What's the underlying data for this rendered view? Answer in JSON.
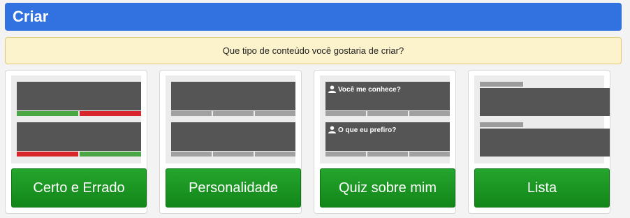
{
  "header": {
    "title": "Criar"
  },
  "prompt": {
    "text": "Que tipo de conteúdo você gostaria de criar?"
  },
  "cards": [
    {
      "button_label": "Certo e Errado"
    },
    {
      "button_label": "Personalidade"
    },
    {
      "button_label": "Quiz sobre mim",
      "questions": [
        "Você me conhece?",
        "O que eu prefiro?"
      ]
    },
    {
      "button_label": "Lista"
    }
  ],
  "colors": {
    "header": "#3272e0",
    "button": "#1a9622",
    "correct": "#4ba646",
    "wrong": "#d8262c"
  }
}
